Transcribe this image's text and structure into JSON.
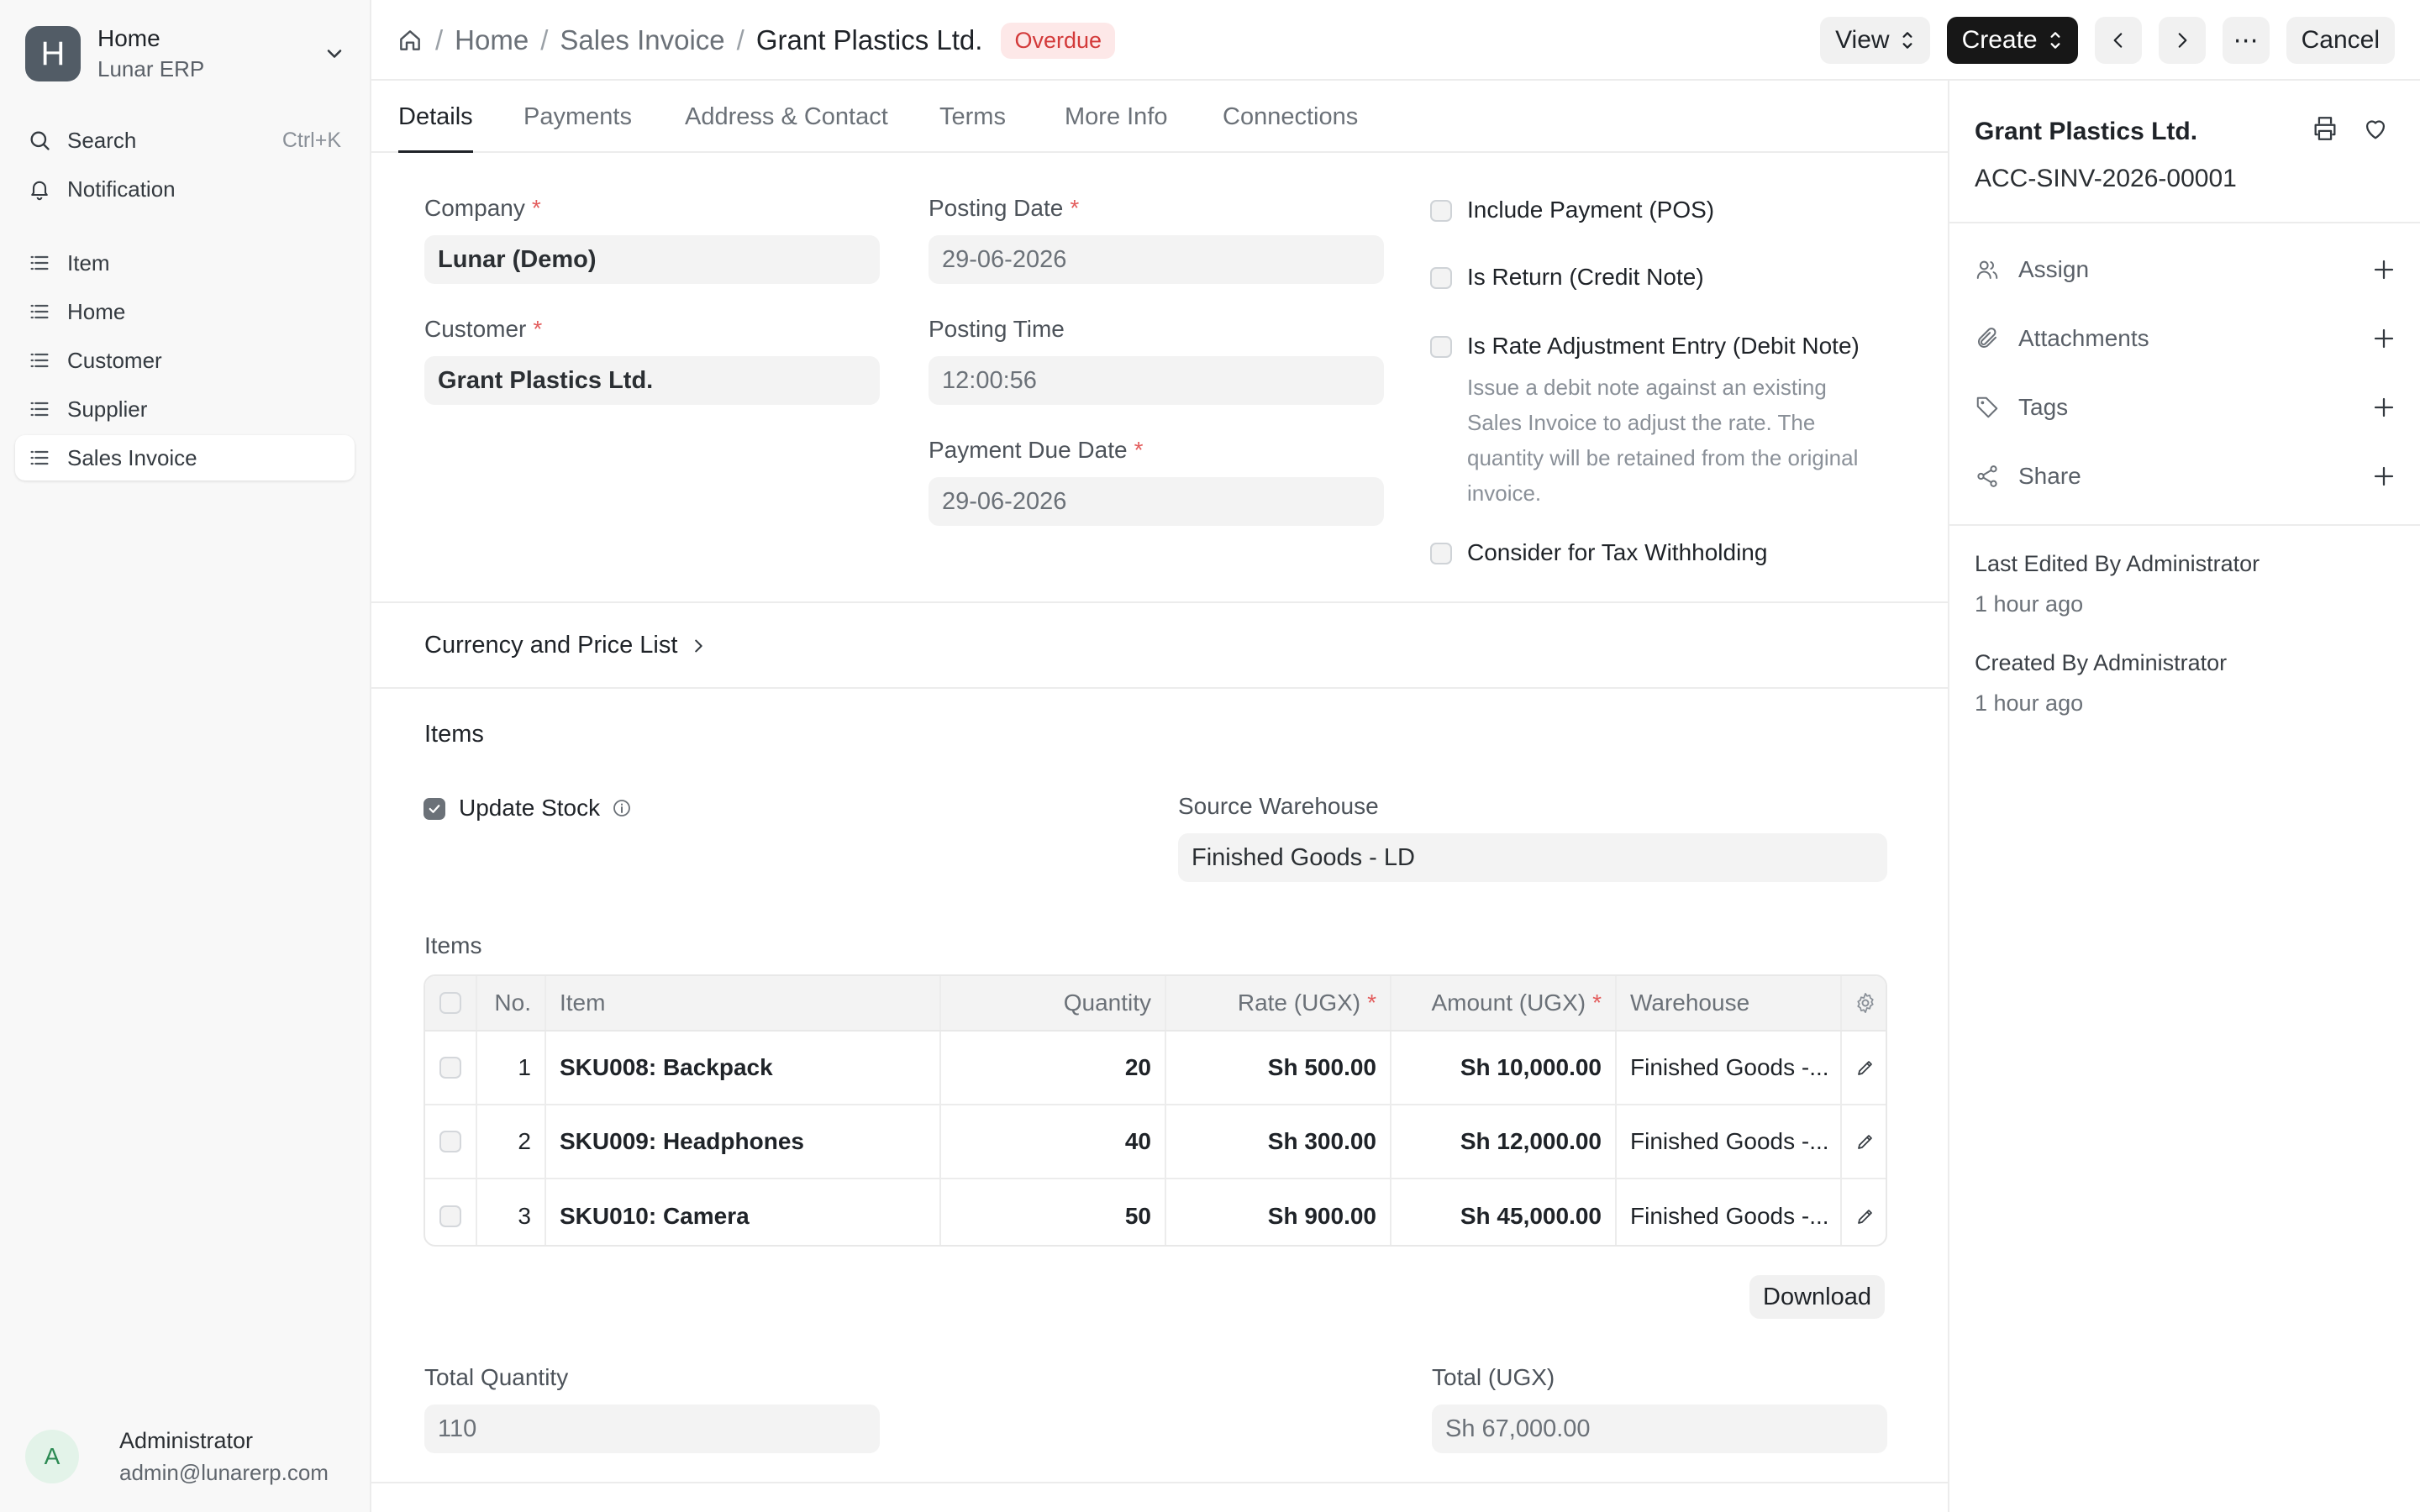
{
  "workspace": {
    "logo_letter": "H",
    "title": "Home",
    "subtitle": "Lunar ERP"
  },
  "sidebar": {
    "search_label": "Search",
    "search_shortcut": "Ctrl+K",
    "notification_label": "Notification",
    "items": [
      {
        "label": "Item"
      },
      {
        "label": "Home"
      },
      {
        "label": "Customer"
      },
      {
        "label": "Supplier"
      },
      {
        "label": "Sales Invoice"
      }
    ],
    "user": {
      "initial": "A",
      "name": "Administrator",
      "email": "admin@lunarerp.com"
    }
  },
  "breadcrumb": {
    "home": "Home",
    "doctype": "Sales Invoice",
    "current": "Grant Plastics Ltd.",
    "status": "Overdue"
  },
  "toolbar": {
    "view_label": "View",
    "create_label": "Create",
    "more_label": "⋯",
    "cancel_label": "Cancel"
  },
  "tabs": [
    "Details",
    "Payments",
    "Address & Contact",
    "Terms",
    "More Info",
    "Connections"
  ],
  "form": {
    "company_label": "Company",
    "company_value": "Lunar (Demo)",
    "customer_label": "Customer",
    "customer_value": "Grant Plastics Ltd.",
    "posting_date_label": "Posting Date",
    "posting_date_value": "29-06-2026",
    "posting_time_label": "Posting Time",
    "posting_time_value": "12:00:56",
    "due_date_label": "Payment Due Date",
    "due_date_value": "29-06-2026",
    "include_payment_label": "Include Payment (POS)",
    "is_return_label": "Is Return (Credit Note)",
    "rate_adjust_label": "Is Rate Adjustment Entry (Debit Note)",
    "rate_adjust_desc": "Issue a debit note against an existing Sales Invoice to adjust the rate. The quantity will be retained from the original invoice.",
    "tax_withholding_label": "Consider for Tax Withholding",
    "required_mark": "*"
  },
  "currency_section": {
    "label": "Currency and Price List"
  },
  "items_section": {
    "title": "Items",
    "update_stock_label": "Update Stock",
    "update_stock_checked": true,
    "source_warehouse_label": "Source Warehouse",
    "source_warehouse_value": "Finished Goods - LD",
    "table_label": "Items",
    "columns": {
      "no": "No.",
      "item": "Item",
      "quantity": "Quantity",
      "rate": "Rate (UGX)",
      "amount": "Amount (UGX)",
      "warehouse": "Warehouse"
    },
    "rows": [
      {
        "no": "1",
        "item": "SKU008: Backpack",
        "quantity": "20",
        "rate": "Sh 500.00",
        "amount": "Sh 10,000.00",
        "warehouse": "Finished Goods -..."
      },
      {
        "no": "2",
        "item": "SKU009: Headphones",
        "quantity": "40",
        "rate": "Sh 300.00",
        "amount": "Sh 12,000.00",
        "warehouse": "Finished Goods -..."
      },
      {
        "no": "3",
        "item": "SKU010: Camera",
        "quantity": "50",
        "rate": "Sh 900.00",
        "amount": "Sh 45,000.00",
        "warehouse": "Finished Goods -..."
      }
    ],
    "download_label": "Download",
    "total_qty_label": "Total Quantity",
    "total_qty_value": "110",
    "total_label": "Total (UGX)",
    "total_value": "Sh 67,000.00"
  },
  "right_panel": {
    "title": "Grant Plastics Ltd.",
    "doc_id": "ACC-SINV-2026-00001",
    "actions": [
      "Assign",
      "Attachments",
      "Tags",
      "Share"
    ],
    "last_edited": "Last Edited By Administrator",
    "last_edited_time": "1 hour ago",
    "created": "Created By Administrator",
    "created_time": "1 hour ago"
  },
  "colors": {
    "accent_dark": "#171717",
    "overdue_bg": "#fde8e8",
    "overdue_text": "#d33a3a",
    "required": "#e35d5d"
  }
}
